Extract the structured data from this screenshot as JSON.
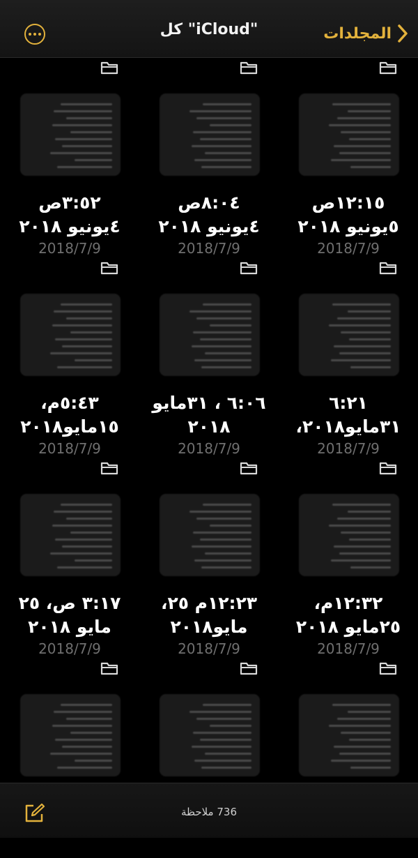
{
  "nav": {
    "back_label": "المجلدات",
    "title": "كل \"iCloud\""
  },
  "icons": {
    "back": "chevron-left-icon",
    "more": "ellipsis-circle-icon",
    "folder": "folder-icon",
    "compose": "compose-icon"
  },
  "colors": {
    "accent": "#e3b23c",
    "background": "#000000"
  },
  "notes": [
    {
      "line1": "١٢:١٥ص",
      "line2": "٥يونيو ٢٠١٨",
      "date": "2018/7/9"
    },
    {
      "line1": "٨:٠٤ص",
      "line2": "٤يونيو ٢٠١٨",
      "date": "2018/7/9"
    },
    {
      "line1": "٣:٥٢ص",
      "line2": "٤يونيو ٢٠١٨",
      "date": "2018/7/9"
    },
    {
      "line1": "٦:٢١",
      "line2": "٣١مايو٢٠١٨،",
      "date": "2018/7/9"
    },
    {
      "line1": "٦:٠٦ ، ٣١مايو",
      "line2": "٢٠١٨",
      "date": "2018/7/9"
    },
    {
      "line1": "٥:٤٣م،",
      "line2": "١٥مايو٢٠١٨",
      "date": "2018/7/9"
    },
    {
      "line1": "١٢:٣٢م،",
      "line2": "٢٥مايو ٢٠١٨",
      "date": "2018/7/9"
    },
    {
      "line1": "١٢:٢٣م ٢٥،",
      "line2": "مايو٢٠١٨",
      "date": "2018/7/9"
    },
    {
      "line1": "٣:١٧ ص، ٢٥",
      "line2": "مايو ٢٠١٨",
      "date": "2018/7/9"
    },
    {
      "line1": "",
      "line2": "",
      "date": ""
    },
    {
      "line1": "",
      "line2": "",
      "date": ""
    },
    {
      "line1": "",
      "line2": "",
      "date": ""
    }
  ],
  "toolbar": {
    "count_label": "736 ملاحظة"
  }
}
